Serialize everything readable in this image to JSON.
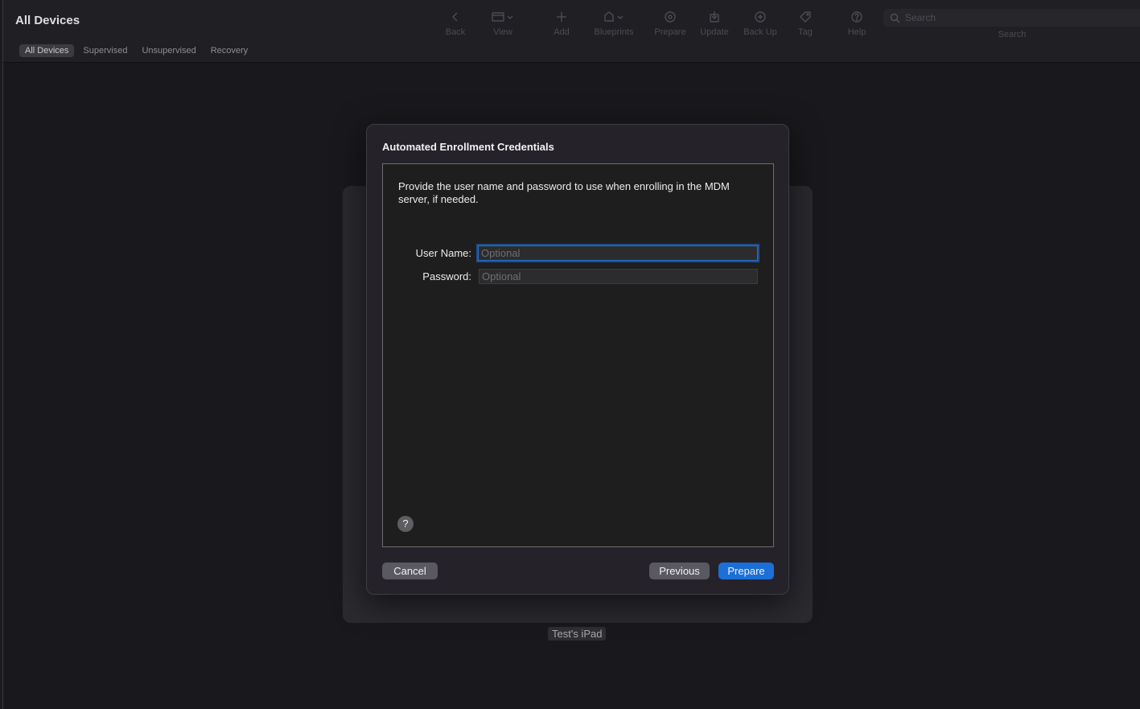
{
  "app": {
    "title": "All Devices"
  },
  "scope_tabs": [
    {
      "label": "All Devices",
      "active": true
    },
    {
      "label": "Supervised",
      "active": false
    },
    {
      "label": "Unsupervised",
      "active": false
    },
    {
      "label": "Recovery",
      "active": false
    }
  ],
  "toolbar": {
    "items": [
      {
        "label": "Back",
        "icon": "chevron-left-icon"
      },
      {
        "label": "View",
        "icon": "view-icon"
      },
      {
        "label": "Add",
        "icon": "plus-icon"
      },
      {
        "label": "Blueprints",
        "icon": "blueprints-icon"
      },
      {
        "label": "Prepare",
        "icon": "prepare-icon"
      },
      {
        "label": "Update",
        "icon": "update-icon"
      },
      {
        "label": "Back Up",
        "icon": "backup-icon"
      },
      {
        "label": "Tag",
        "icon": "tag-icon"
      },
      {
        "label": "Help",
        "icon": "help-icon"
      }
    ],
    "search_placeholder": "Search",
    "search_caption": "Search"
  },
  "device": {
    "name": "Test's iPad"
  },
  "sheet": {
    "title": "Automated Enrollment Credentials",
    "description": "Provide the user name and password to use when enrolling in the MDM server, if needed.",
    "username_label": "User Name:",
    "username_placeholder": "Optional",
    "password_label": "Password:",
    "password_placeholder": "Optional",
    "help_label": "?",
    "cancel_label": "Cancel",
    "previous_label": "Previous",
    "prepare_label": "Prepare"
  },
  "colors": {
    "accent": "#1c6fd9",
    "focus_ring": "#2a6ec6"
  }
}
